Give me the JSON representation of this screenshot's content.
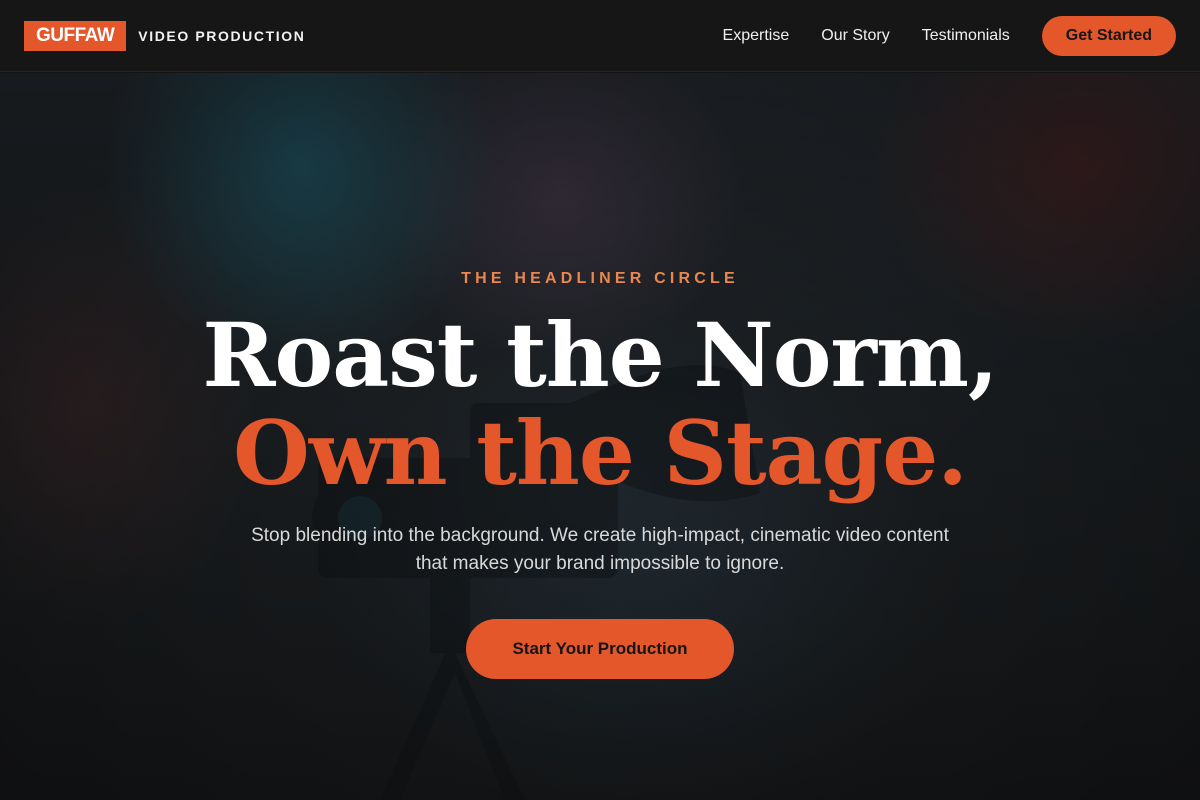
{
  "header": {
    "logo_text": "GUFFAW",
    "logo_subtitle": "VIDEO PRODUCTION",
    "nav": [
      {
        "label": "Expertise"
      },
      {
        "label": "Our Story"
      },
      {
        "label": "Testimonials"
      }
    ],
    "cta_label": "Get Started"
  },
  "hero": {
    "eyebrow": "THE HEADLINER CIRCLE",
    "headline_line1": "Roast the Norm,",
    "headline_line2": "Own the Stage.",
    "subtext": "Stop blending into the background. We create high-impact, cinematic video content that makes your brand impossible to ignore.",
    "button_label": "Start Your Production",
    "background_image": "camera-on-tripod-photo"
  },
  "colors": {
    "accent": "#e3572a",
    "eyebrow": "#e9874f",
    "header_bg": "#161616",
    "text_light": "#f0f0f0"
  }
}
